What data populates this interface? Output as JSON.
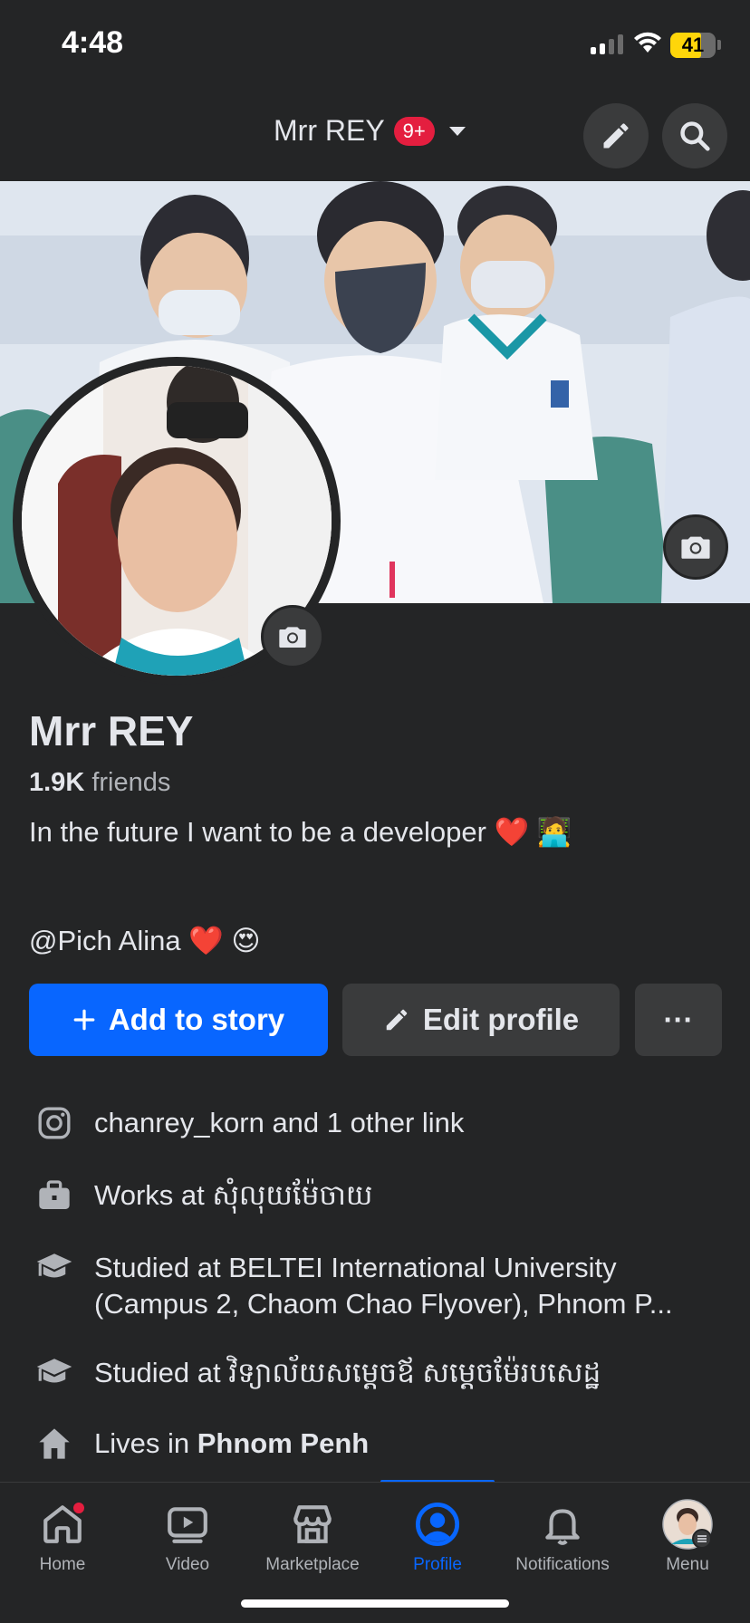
{
  "status_bar": {
    "time": "4:48",
    "battery": "41"
  },
  "header": {
    "title": "Mrr REY",
    "badge": "9+"
  },
  "profile": {
    "name": "Mrr REY",
    "friends_count": "1.9K",
    "friends_label": "friends",
    "bio_line1": "In the future I want to be a developer ❤️ 🧑‍💻",
    "bio_line2": "@Pich Alina ❤️ 😍"
  },
  "actions": {
    "add_story": "Add to story",
    "edit_profile": "Edit profile",
    "more": "···"
  },
  "details": [
    {
      "icon": "instagram-icon",
      "text": "chanrey_korn and 1 other link"
    },
    {
      "icon": "briefcase-icon",
      "text": "Works at សុំលុយម៉ែចាយ"
    },
    {
      "icon": "graduation-cap-icon",
      "text": "Studied at BELTEI International University (Campus 2, Chaom Chao Flyover), Phnom P..."
    },
    {
      "icon": "graduation-cap-icon",
      "text": "Studied at វិទ្យាល័យសម្តេចឪ សម្តេចម៉ែរបសេដ្ឋ"
    },
    {
      "icon": "house-icon",
      "text_prefix": "Lives in",
      "text_bold": "Phnom Penh"
    }
  ],
  "nav": {
    "home": "Home",
    "video": "Video",
    "marketplace": "Marketplace",
    "profile": "Profile",
    "notifications": "Notifications",
    "menu": "Menu"
  },
  "colors": {
    "background": "#242526",
    "accent": "#0866ff",
    "badge": "#e41e3f",
    "secondary_button": "#3a3b3c"
  }
}
